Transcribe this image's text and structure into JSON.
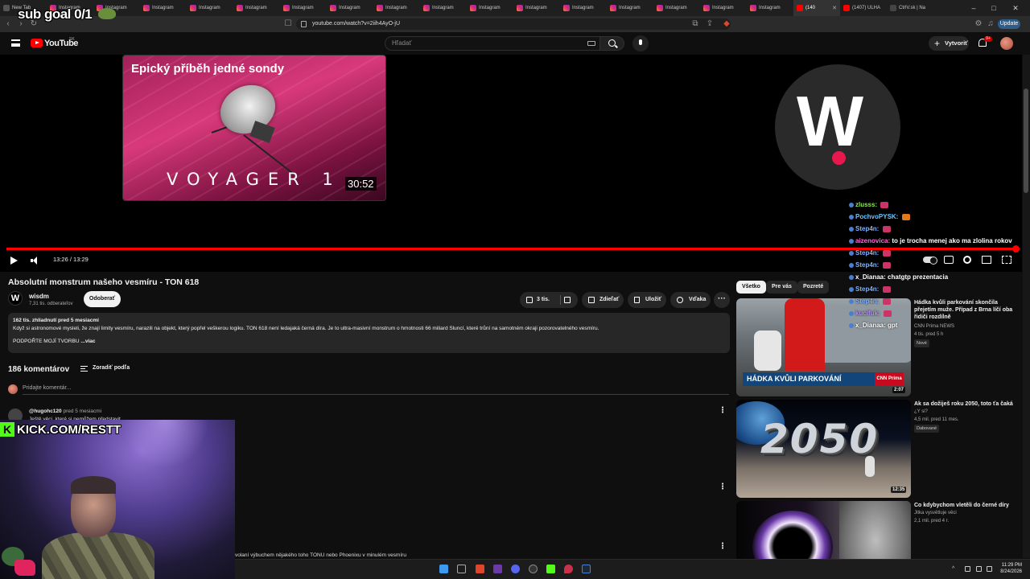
{
  "overlay": {
    "sub_goal": "sub goal 0/1",
    "kick_url": "KICK.COM/RESTT",
    "kick_k": "K"
  },
  "browser": {
    "tabs": [
      {
        "label": "New Tab",
        "icon": "blank"
      },
      {
        "label": "Instagram",
        "icon": "instagram"
      },
      {
        "label": "Instagram",
        "icon": "instagram"
      },
      {
        "label": "Instagram",
        "icon": "instagram"
      },
      {
        "label": "Instagram",
        "icon": "instagram"
      },
      {
        "label": "Instagram",
        "icon": "instagram"
      },
      {
        "label": "Instagram",
        "icon": "instagram"
      },
      {
        "label": "Instagram",
        "icon": "instagram"
      },
      {
        "label": "Instagram",
        "icon": "instagram"
      },
      {
        "label": "Instagram",
        "icon": "instagram"
      },
      {
        "label": "Instagram",
        "icon": "instagram"
      },
      {
        "label": "Instagram",
        "icon": "instagram"
      },
      {
        "label": "Instagram",
        "icon": "instagram"
      },
      {
        "label": "Instagram",
        "icon": "instagram"
      },
      {
        "label": "Instagram",
        "icon": "instagram"
      },
      {
        "label": "Instagram",
        "icon": "instagram"
      },
      {
        "label": "Instagram",
        "icon": "instagram"
      },
      {
        "label": "(140",
        "icon": "youtube",
        "active": true
      },
      {
        "label": "(1407) ULHA",
        "icon": "youtube"
      },
      {
        "label": "CtrlV.sk | Na",
        "icon": "chat"
      }
    ],
    "url": "youtube.com/watch?v=2iih4AyO-jU",
    "update_label": "Update"
  },
  "yt_header": {
    "logo_text": "YouTube",
    "country": "SK",
    "search_placeholder": "Hľadať",
    "create_label": "Vytvoriť",
    "notif_count": "9+"
  },
  "player": {
    "thumb_title": "Epický příběh jedné sondy",
    "thumb_voyager": "VOYAGER 1",
    "thumb_duration": "30:52",
    "time": "13:26 / 13:29",
    "progress": 1.0,
    "channel_logo_letter": "W"
  },
  "chat": [
    {
      "user": "zlusss:",
      "msg": ""
    },
    {
      "user": "PochvoPYSK:",
      "msg": ""
    },
    {
      "user": "Step4n:",
      "msg": ""
    },
    {
      "user": "aizenovica:",
      "msg": "to je trocha menej ako ma zlolina rokov"
    },
    {
      "user": "Step4n:",
      "msg": ""
    },
    {
      "user": "Step4n:",
      "msg": ""
    },
    {
      "user": "x_Dianaa:",
      "msg": "chatgtp prezentacia"
    },
    {
      "user": "Step4n:",
      "msg": ""
    },
    {
      "user": "Step4n:",
      "msg": ""
    },
    {
      "user": "kucifuk:",
      "msg": ""
    },
    {
      "user": "x_Dianaa:",
      "msg": "gpt"
    }
  ],
  "video": {
    "title": "Absolutní monstrum našeho vesmíru - TON 618",
    "channel": "wisdm",
    "channel_avatar": "W",
    "subscribers": "7,31 tis. odberateľov",
    "unsubscribe_label": "Odoberať",
    "likes": "3 tis.",
    "share_label": "Zdieľať",
    "save_label": "Uložiť",
    "thanks_label": "Vďaka",
    "more_label": "···",
    "desc_meta": "162 tis. zhliadnutí  pred 5 mesiacmi",
    "desc_text": "Když si astronomové mysleli, že znají limity vesmíru, narazili na objekt, který popřel veškerou logiku. TON 618 není ledajaká černá díra. Je to ultra-masivní monstrum o hmotnosti 66 miliard Sluncí, které trůní na samotném okraji pozorovatelného vesmíru.",
    "desc_support": "PODPOŘTE MOJÍ TVORBU",
    "desc_more": "...viac"
  },
  "comments": {
    "count": "186 komentárov",
    "sort_label": "Zoradiť podľa",
    "add_placeholder": "Pridajte komentár...",
    "first_author": "@hugohc120",
    "first_time": "pred 5 mesiacmi",
    "first_text": "Ještě věci, které si nemůžem představit",
    "partial_text": "volaní výbuchem nějakého toho TONU nebo Phoenixu v minulém vesmíru"
  },
  "sidebar": {
    "chips": [
      "Všetko",
      "Pre vás",
      "Pozreté"
    ],
    "recs": [
      {
        "title": "Hádka kvůli parkování skončila přejetím muže. Případ z Brna líčí oba řidiči rozdílně",
        "channel": "CNN Prima NEWS",
        "meta": "4 tis.  pred 5 h",
        "badge": "Nové",
        "duration": "2:07",
        "banner": "HÁDKA KVŮLI PARKOVÁNÍ",
        "cnn": "CNN Prima"
      },
      {
        "title": "Ak sa dožiješ roku 2050, toto ťa čaká",
        "channel": "¿Y si?",
        "meta": "4,5 mil.  pred 11 mes.",
        "badge": "Dabované",
        "duration": "12:35",
        "big_text": "2050"
      },
      {
        "title": "Co kdybychom vletěli do černé díry",
        "channel": "Jitka vysvětluje věci",
        "meta": "2,1 mil.  pred 4 r."
      }
    ]
  },
  "taskbar": {
    "time": "11:29 PM",
    "date": "8/24/2026"
  },
  "colors": {
    "accent_red": "#ff0000",
    "kick_green": "#53fc18",
    "w_logo_dot": "#e8184d"
  }
}
